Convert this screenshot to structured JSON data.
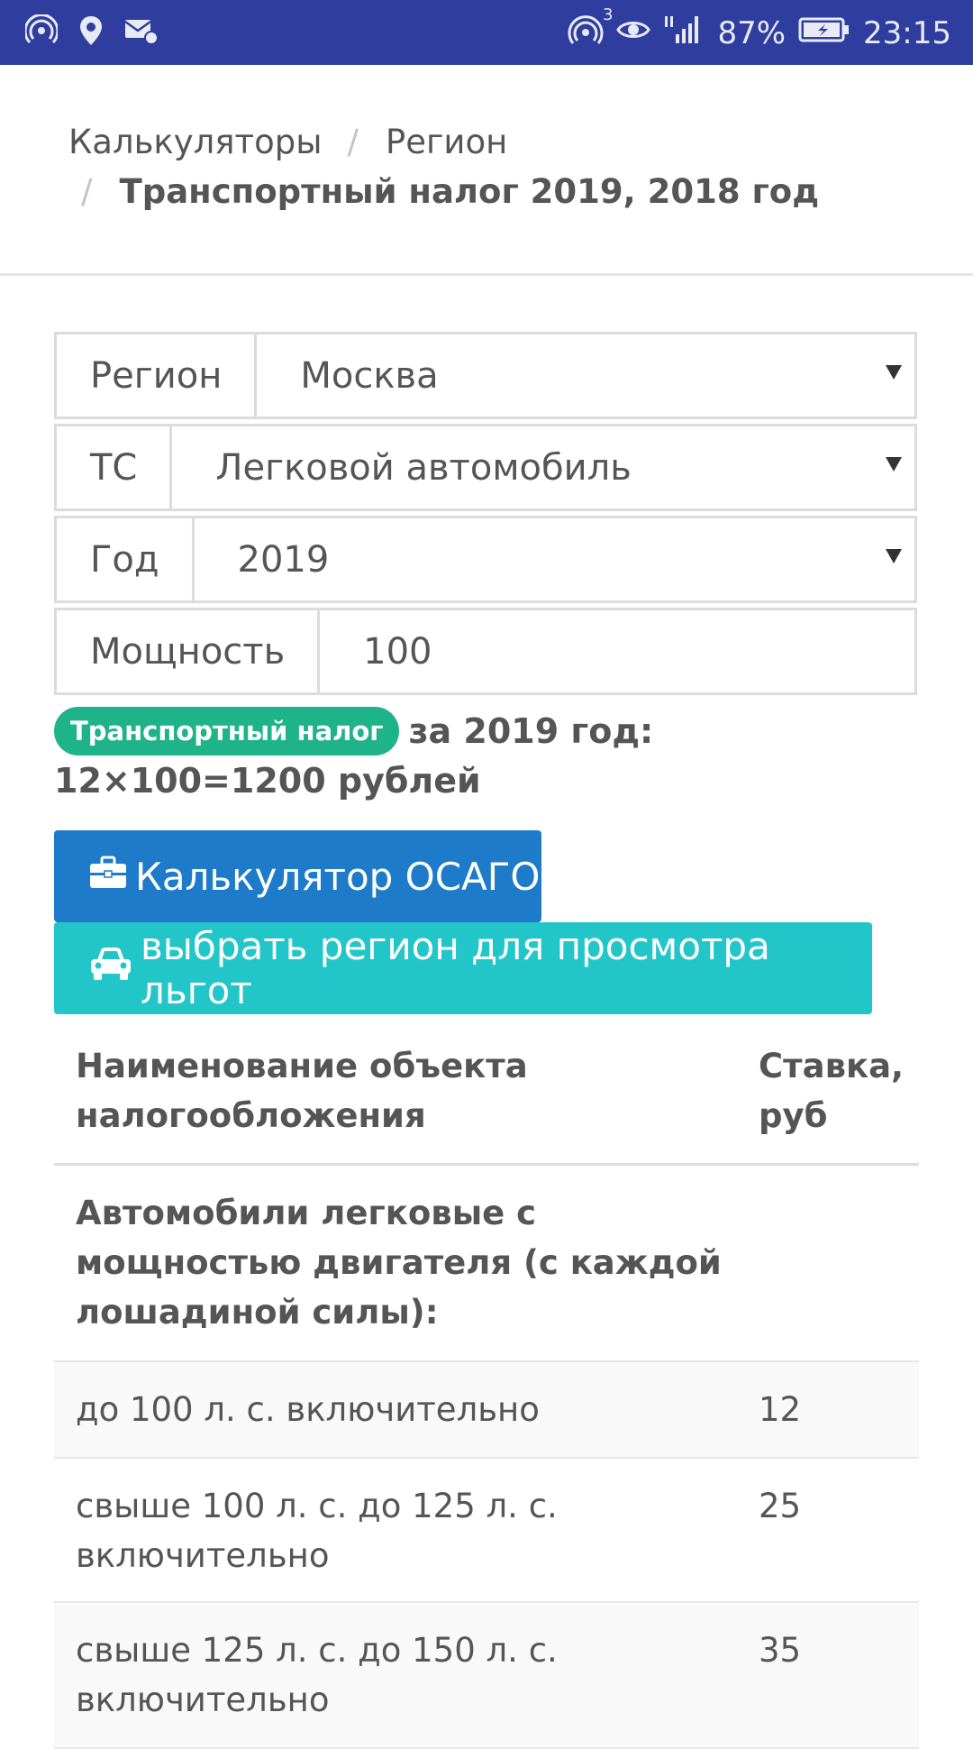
{
  "status_bar": {
    "notif_icons": [
      "hotspot-icon",
      "location-pin-icon",
      "mail-settings-icon"
    ],
    "wifi_badge": "3",
    "battery_percent": "87%",
    "time": "23:15"
  },
  "breadcrumb": {
    "items": [
      "Калькуляторы",
      "Регион"
    ],
    "current": "Транспортный налог 2019, 2018 год",
    "separator": "/"
  },
  "form": {
    "region": {
      "label": "Регион",
      "value": "Москва"
    },
    "vehicle": {
      "label": "ТС",
      "value": "Легковой автомобиль"
    },
    "year": {
      "label": "Год",
      "value": "2019"
    },
    "power": {
      "label": "Мощность",
      "value": "100"
    }
  },
  "result": {
    "badge": "Транспортный налог",
    "text": "за 2019 год: 12×100=1200 рублей"
  },
  "buttons": {
    "osago": "Калькулятор ОСАГО",
    "region_benefits": "выбрать регион для просмотра льгот"
  },
  "table": {
    "headers": [
      "Наименование объекта налогообложения",
      "Ставка, руб"
    ],
    "section": "Автомобили легковые с мощностью двигателя (с каждой лошадиной силы):",
    "rows": [
      {
        "name": "до 100 л. с. включительно",
        "rate": "12"
      },
      {
        "name": "свыше 100 л. с. до 125 л. с. включительно",
        "rate": "25"
      },
      {
        "name": "свыше 125 л. с. до 150 л. с. включительно",
        "rate": "35"
      }
    ]
  },
  "colors": {
    "status_bar": "#2f3d9e",
    "badge": "#1fb38a",
    "osago_button": "#1e7bc9",
    "region_button": "#23c6c8"
  }
}
